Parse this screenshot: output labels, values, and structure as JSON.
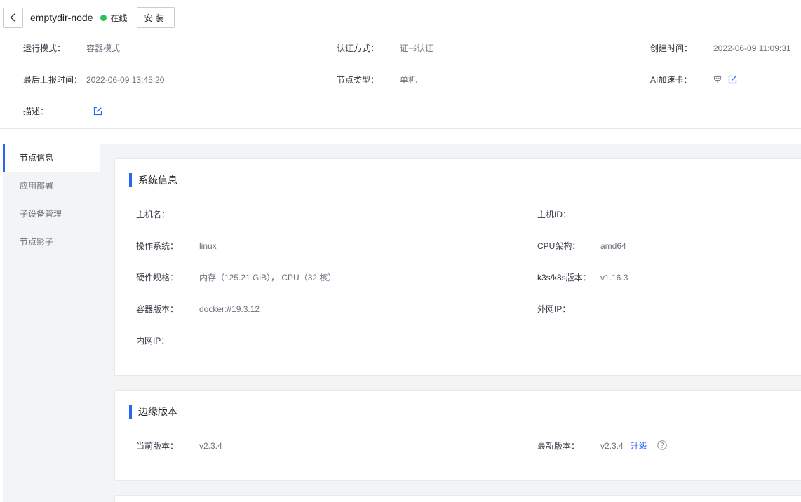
{
  "header": {
    "node_name": "emptydir-node",
    "status_text": "在线",
    "status_color": "#2bc258",
    "install_label": "安装",
    "info": {
      "run_mode_label": "运行模式：",
      "run_mode_value": "容器模式",
      "auth_label": "认证方式：",
      "auth_value": "证书认证",
      "created_label": "创建时间：",
      "created_value": "2022-06-09 11:09:31",
      "last_report_label": "最后上报时间：",
      "last_report_value": "2022-06-09 13:45:20",
      "node_type_label": "节点类型：",
      "node_type_value": "单机",
      "ai_label": "AI加速卡：",
      "ai_value": "空",
      "desc_label": "描述："
    }
  },
  "sidebar": {
    "items": [
      {
        "label": "节点信息",
        "active": true
      },
      {
        "label": "应用部署",
        "active": false
      },
      {
        "label": "子设备管理",
        "active": false
      },
      {
        "label": "节点影子",
        "active": false
      }
    ]
  },
  "system_info": {
    "title": "系统信息",
    "hostname_label": "主机名：",
    "hostname_value": "",
    "host_id_label": "主机ID：",
    "host_id_value": "",
    "os_label": "操作系统：",
    "os_value": "linux",
    "cpu_arch_label": "CPU架构：",
    "cpu_arch_value": "amd64",
    "hardware_label": "硬件规格：",
    "hardware_value": "内存（125.21 GiB），  CPU（32 核）",
    "k8s_label": "k3s/k8s版本：",
    "k8s_value": "v1.16.3",
    "container_label": "容器版本：",
    "container_value": "docker://19.3.12",
    "public_ip_label": "外网IP：",
    "public_ip_value": "",
    "private_ip_label": "内网IP：",
    "private_ip_value": ""
  },
  "edge_version": {
    "title": "边缘版本",
    "current_label": "当前版本：",
    "current_value": "v2.3.4",
    "latest_label": "最新版本：",
    "latest_value": "v2.3.4",
    "upgrade_label": "升级"
  },
  "colors": {
    "accent": "#2468f2",
    "online": "#2bc258"
  }
}
